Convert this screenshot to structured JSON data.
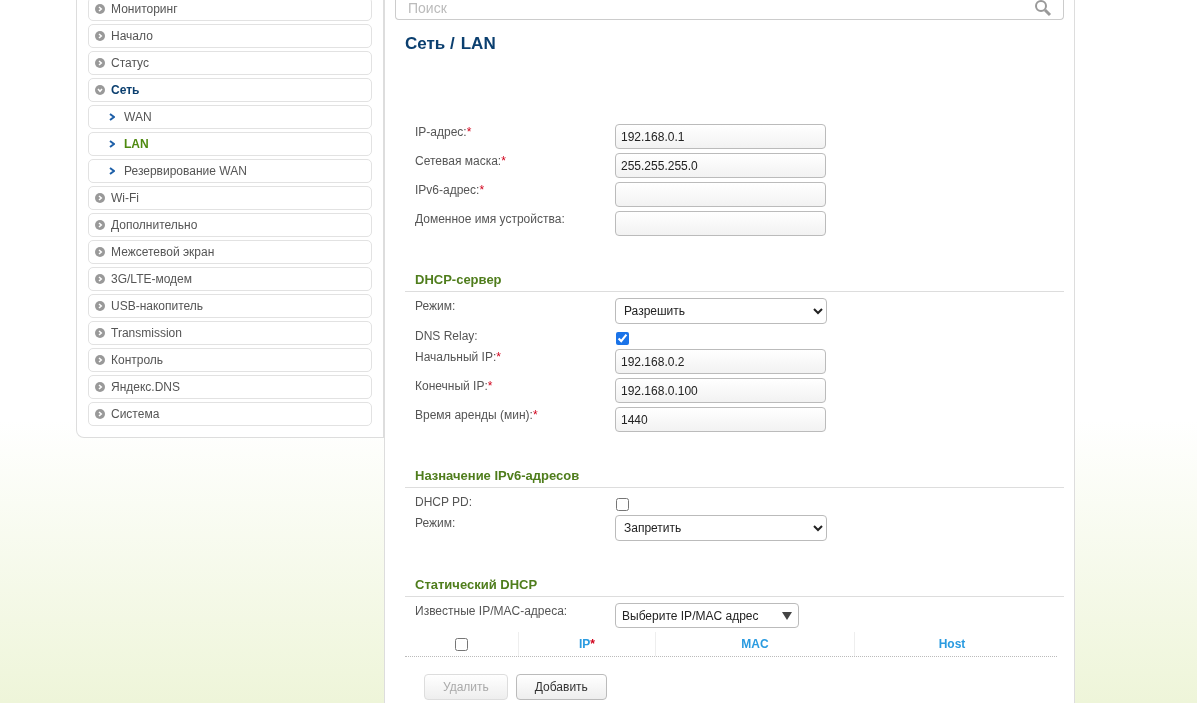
{
  "sidebar": {
    "items": [
      {
        "label": "Мониторинг",
        "expanded": false,
        "selected": false
      },
      {
        "label": "Начало",
        "expanded": false,
        "selected": false
      },
      {
        "label": "Статус",
        "expanded": false,
        "selected": false
      },
      {
        "label": "Сеть",
        "expanded": true,
        "selected": false,
        "children": [
          {
            "label": "WAN",
            "selected": false
          },
          {
            "label": "LAN",
            "selected": true
          },
          {
            "label": "Резервирование WAN",
            "selected": false
          }
        ]
      },
      {
        "label": "Wi-Fi",
        "expanded": false,
        "selected": false
      },
      {
        "label": "Дополнительно",
        "expanded": false,
        "selected": false
      },
      {
        "label": "Межсетевой экран",
        "expanded": false,
        "selected": false
      },
      {
        "label": "3G/LTE-модем",
        "expanded": false,
        "selected": false
      },
      {
        "label": "USB-накопитель",
        "expanded": false,
        "selected": false
      },
      {
        "label": "Transmission",
        "expanded": false,
        "selected": false
      },
      {
        "label": "Контроль",
        "expanded": false,
        "selected": false
      },
      {
        "label": "Яндекс.DNS",
        "expanded": false,
        "selected": false
      },
      {
        "label": "Система",
        "expanded": false,
        "selected": false
      }
    ]
  },
  "search": {
    "placeholder": "Поиск"
  },
  "breadcrumb": {
    "parent": "Сеть /",
    "current": "LAN"
  },
  "sections": [
    {
      "rows": [
        {
          "kind": "input",
          "label": "IP-адрес:",
          "mark": "*",
          "value": "192.168.0.1"
        },
        {
          "kind": "input",
          "label": "Сетевая маска:",
          "mark": "*",
          "value": "255.255.255.0"
        },
        {
          "kind": "input",
          "label": "IPv6-адрес:",
          "mark": "*"
        },
        {
          "kind": "input",
          "label": "Доменное имя устройства:"
        }
      ]
    },
    {
      "title": "DHCP-сервер",
      "rows": [
        {
          "kind": "select",
          "label": "Режим:",
          "value": "Разрешить"
        },
        {
          "kind": "checkbox",
          "label": "DNS Relay:",
          "checked": true
        },
        {
          "kind": "input",
          "label": "Начальный IP:",
          "mark": "*",
          "value": "192.168.0.2"
        },
        {
          "kind": "input",
          "label": "Конечный IP:",
          "mark": "*",
          "value": "192.168.0.100"
        },
        {
          "kind": "input",
          "label": "Время аренды (мин):",
          "mark": "*",
          "value": "1440"
        }
      ]
    },
    {
      "title": "Назначение IPv6-адресов",
      "rows": [
        {
          "kind": "checkbox",
          "label": "DHCP PD:",
          "checked": false
        },
        {
          "kind": "select",
          "label": "Режим:",
          "value": "Запретить"
        }
      ]
    },
    {
      "title": "Статический DHCP",
      "rows": [
        {
          "kind": "dropdown",
          "label": "Известные IP/MAC-адреса:",
          "value": "Выберите IP/MAC адрес"
        }
      ]
    }
  ],
  "table": {
    "select_all": {
      "checked": false
    },
    "columns": [
      {
        "label": "IP",
        "mark": "*"
      },
      {
        "label": "MAC"
      },
      {
        "label": "Host"
      }
    ]
  },
  "buttons": [
    {
      "label": "Удалить",
      "disabled": true
    },
    {
      "label": "Добавить",
      "disabled": false
    }
  ]
}
